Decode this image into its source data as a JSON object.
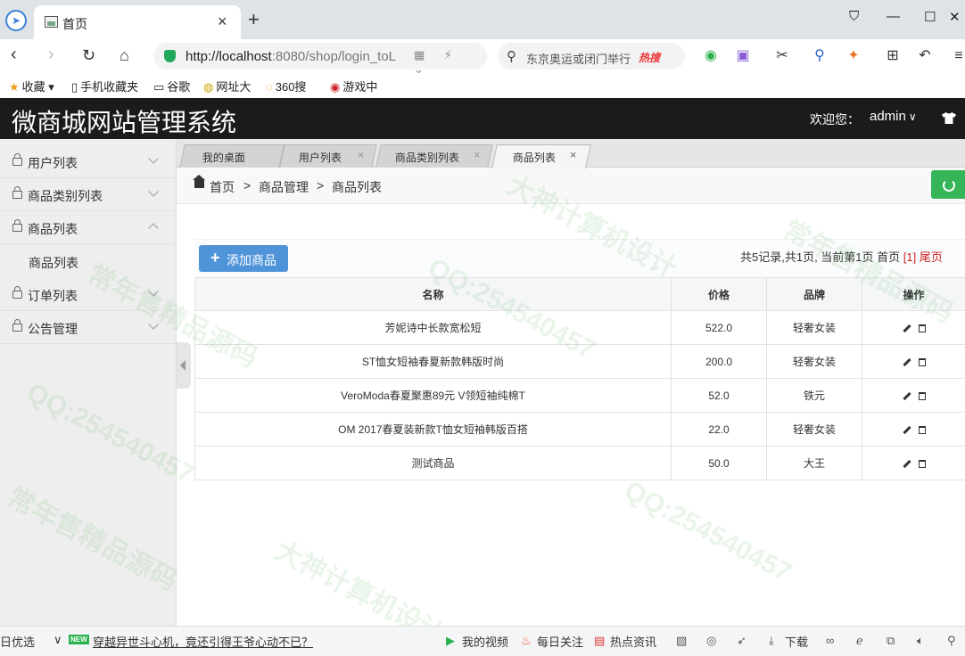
{
  "browser": {
    "tab_title": "首页",
    "url_host": "http://localhost",
    "url_rest": ":8080/shop/login_toL",
    "search_text": "东京奥运或闭门举行",
    "hot_tag": "热搜",
    "bookmarks": [
      "收藏",
      "手机收藏夹",
      "谷歌",
      "网址大",
      "360搜",
      "游戏中"
    ]
  },
  "header": {
    "title": "微商城网站管理系统",
    "welcome": "欢迎您：",
    "user": "admin"
  },
  "sidebar": {
    "items": [
      "用户列表",
      "商品类别列表",
      "商品列表",
      "订单列表",
      "公告管理"
    ],
    "submenu": "商品列表"
  },
  "tabs": [
    "我的桌面",
    "用户列表",
    "商品类别列表",
    "商品列表"
  ],
  "breadcrumb": {
    "home": "首页",
    "sep": ">",
    "level1": "商品管理",
    "level2": "商品列表"
  },
  "toolbar": {
    "add_label": "添加商品",
    "pager_prefix": "共5记录,共1页, 当前第1页 首页 ",
    "pager_current": "[1]",
    "pager_last": " 尾页"
  },
  "table": {
    "headers": [
      "名称",
      "价格",
      "品牌",
      "操作"
    ],
    "rows": [
      {
        "name": "芳妮诗中长款宽松短",
        "price": "522.0",
        "brand": "轻奢女装"
      },
      {
        "name": "ST恤女短袖春夏新款韩版时尚",
        "price": "200.0",
        "brand": "轻奢女装"
      },
      {
        "name": "VeroModa春夏聚惠89元 V领短袖纯棉T",
        "price": "52.0",
        "brand": "铁元"
      },
      {
        "name": "OM 2017春夏装新款T恤女短袖韩版百搭",
        "price": "22.0",
        "brand": "轻奢女装"
      },
      {
        "name": "测试商品",
        "price": "50.0",
        "brand": "大王"
      }
    ]
  },
  "statusbar": {
    "left": "日优选",
    "news": "穿越异世斗心机，竟还引得王爷心动不已？",
    "video": "我的视频",
    "daily": "每日关注",
    "hot": "热点资讯",
    "download": "下载"
  },
  "watermarks": [
    "QQ:254540457",
    "大神计算机设计",
    "常年售精品源码"
  ]
}
